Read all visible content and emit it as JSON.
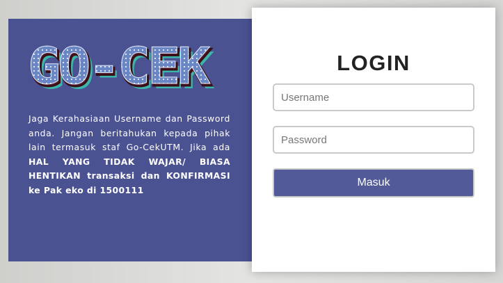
{
  "brand": {
    "logo_text": "GO-CEK"
  },
  "info": {
    "text_normal": "Jaga Kerahasiaan Username dan Password anda. Jangan beritahukan kepada pihak lain termasuk staf Go-CekUTM. Jika ada ",
    "text_bold": "HAL YANG TIDAK WAJAR/ BIASA HENTIKAN transaksi dan KONFIRMASI ke Pak eko di 1500111"
  },
  "login": {
    "title": "LOGIN",
    "username_placeholder": "Username",
    "password_placeholder": "Password",
    "submit_label": "Masuk"
  },
  "colors": {
    "panel": "#4a5292",
    "button": "#525a97",
    "logo_fill": "#6a86c4",
    "logo_shadow": "#3cb5ab"
  }
}
